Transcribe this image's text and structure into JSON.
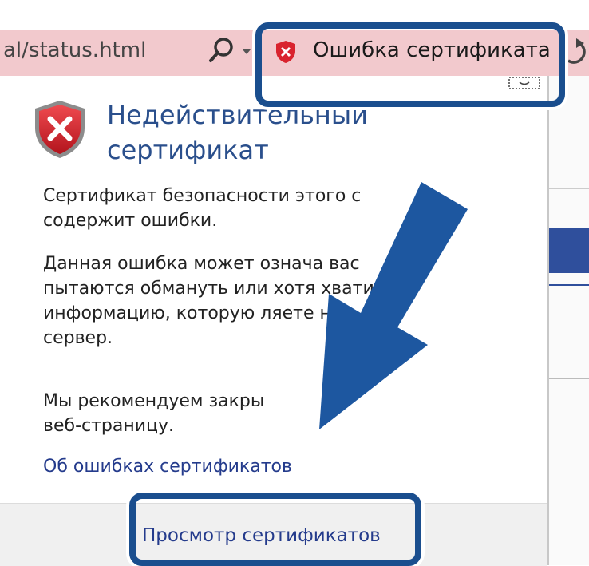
{
  "address_bar": {
    "url": "al/status.html",
    "search_icon": "search-icon",
    "dropdown_icon": "chevron-down-icon"
  },
  "cert_error_tab": {
    "label": "Ошибка сертификата",
    "icon": "shield-error-icon"
  },
  "popup": {
    "title": "Недействительный\nсертификат",
    "paragraphs": [
      "Сертификат безопасности этого с\nсодержит ошибки.",
      "Данная ошибка может означа        вас\nпытаются обмануть или хотя        хватить\nинформацию, которую           ляете на\nсервер.",
      "Мы рекомендуем закры\nвеб-страницу."
    ],
    "learn_more_link": "Об ошибках сертификатов",
    "view_certs_link": "Просмотр сертификатов"
  },
  "colors": {
    "address_bar_bg": "#f2c9cd",
    "title_blue": "#2a4f8c",
    "link_blue": "#243b8c",
    "highlight": "#1a4e8e",
    "shield_red": "#d9232e"
  }
}
